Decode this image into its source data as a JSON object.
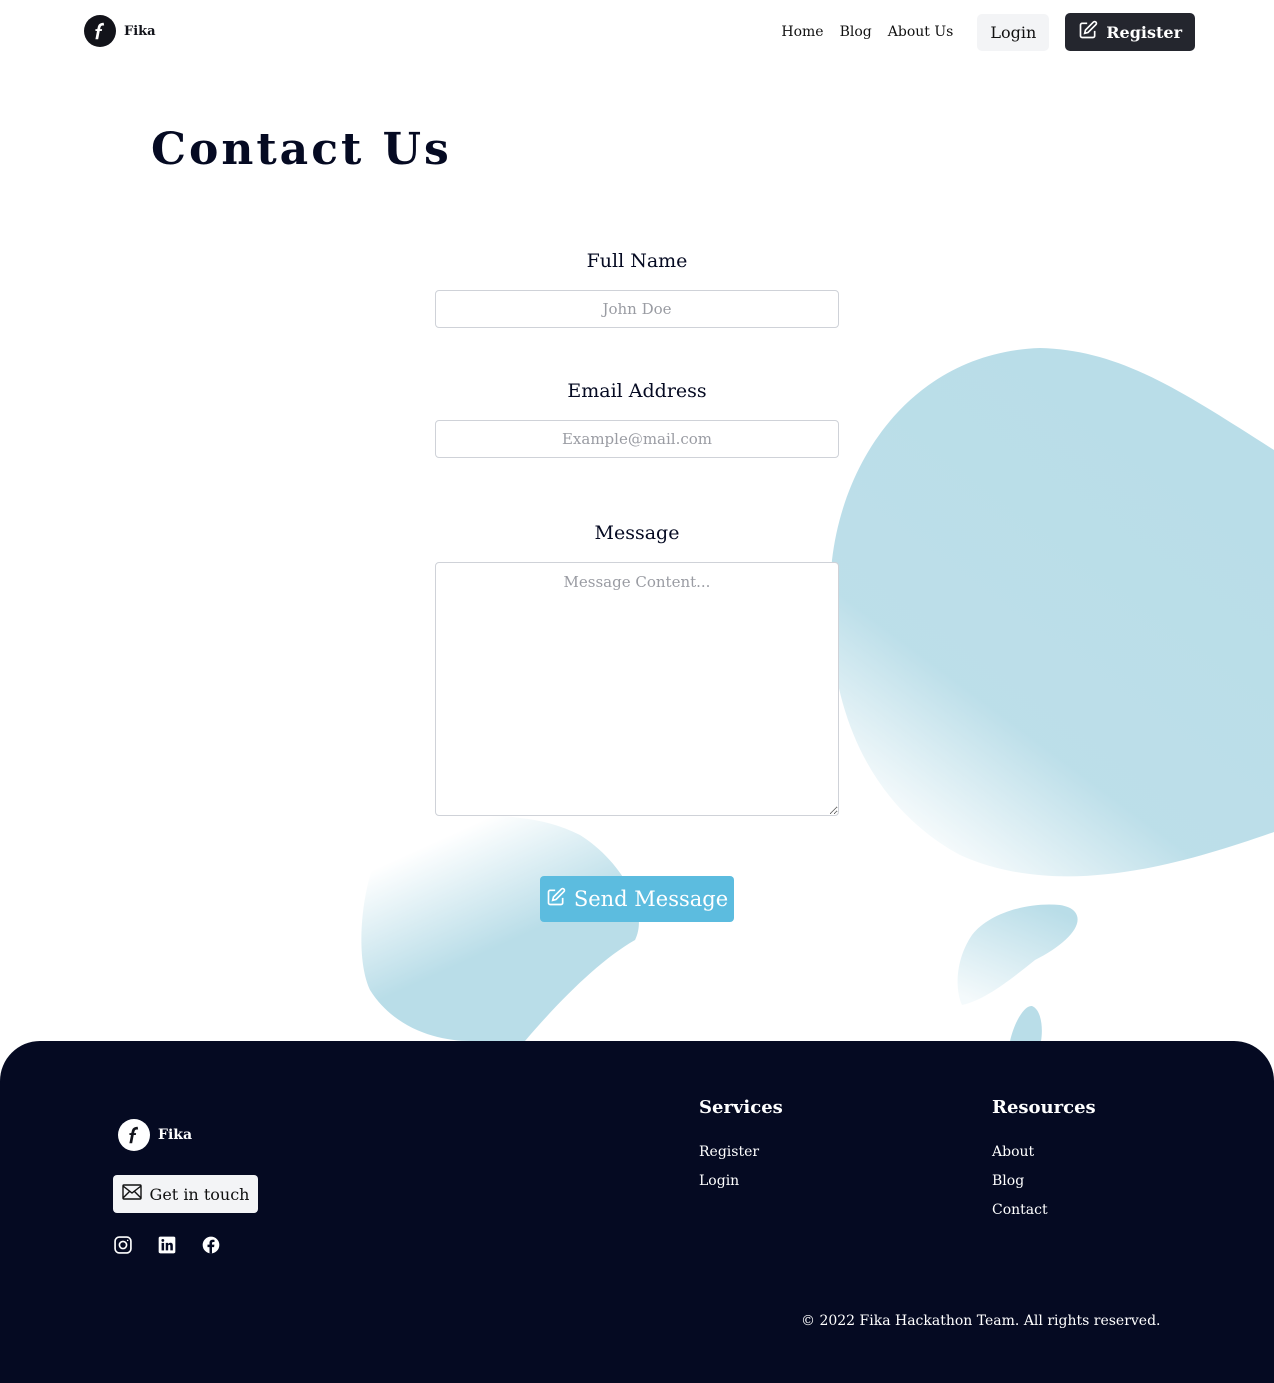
{
  "header": {
    "brand": "Fika",
    "nav": [
      {
        "label": "Home"
      },
      {
        "label": "Blog"
      },
      {
        "label": "About Us"
      }
    ],
    "login_label": "Login",
    "register_label": "Register"
  },
  "main": {
    "title": "Contact Us",
    "fields": {
      "full_name": {
        "label": "Full Name",
        "placeholder": "John Doe"
      },
      "email": {
        "label": "Email Address",
        "placeholder": "Example@mail.com"
      },
      "message": {
        "label": "Message",
        "placeholder": "Message Content..."
      }
    },
    "send_label": "Send Message"
  },
  "footer": {
    "brand": "Fika",
    "touch_label": "Get in touch",
    "socials": [
      "instagram-icon",
      "linkedin-icon",
      "facebook-icon"
    ],
    "services": {
      "title": "Services",
      "links": [
        "Register",
        "Login"
      ]
    },
    "resources": {
      "title": "Resources",
      "links": [
        "About",
        "Blog",
        "Contact"
      ]
    },
    "copyright": "© 2022 Fika Hackathon Team. All rights reserved."
  },
  "colors": {
    "navy": "#050a22",
    "accent": "#5cbcdf",
    "blob": "#b9dde8",
    "dark_button": "#24262e"
  }
}
